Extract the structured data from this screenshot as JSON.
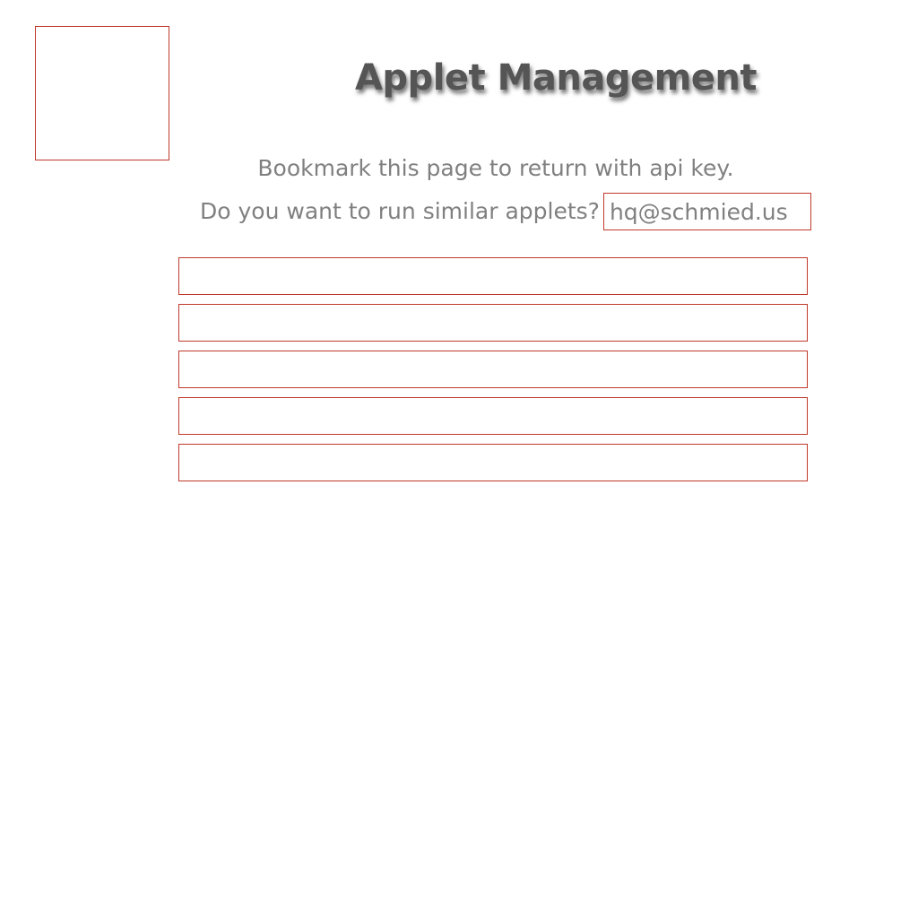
{
  "header": {
    "title": "Applet Management"
  },
  "info": {
    "bookmark_text": "Bookmark this page to return with api key.",
    "question_text": "Do you want to run similar applets?"
  },
  "email": {
    "value": "hq@schmied.us"
  },
  "applets": [
    {
      "label": ""
    },
    {
      "label": ""
    },
    {
      "label": ""
    },
    {
      "label": ""
    },
    {
      "label": ""
    }
  ],
  "colors": {
    "border_accent": "#c0392b",
    "text_gray": "#808080",
    "title_gray": "#555555"
  }
}
